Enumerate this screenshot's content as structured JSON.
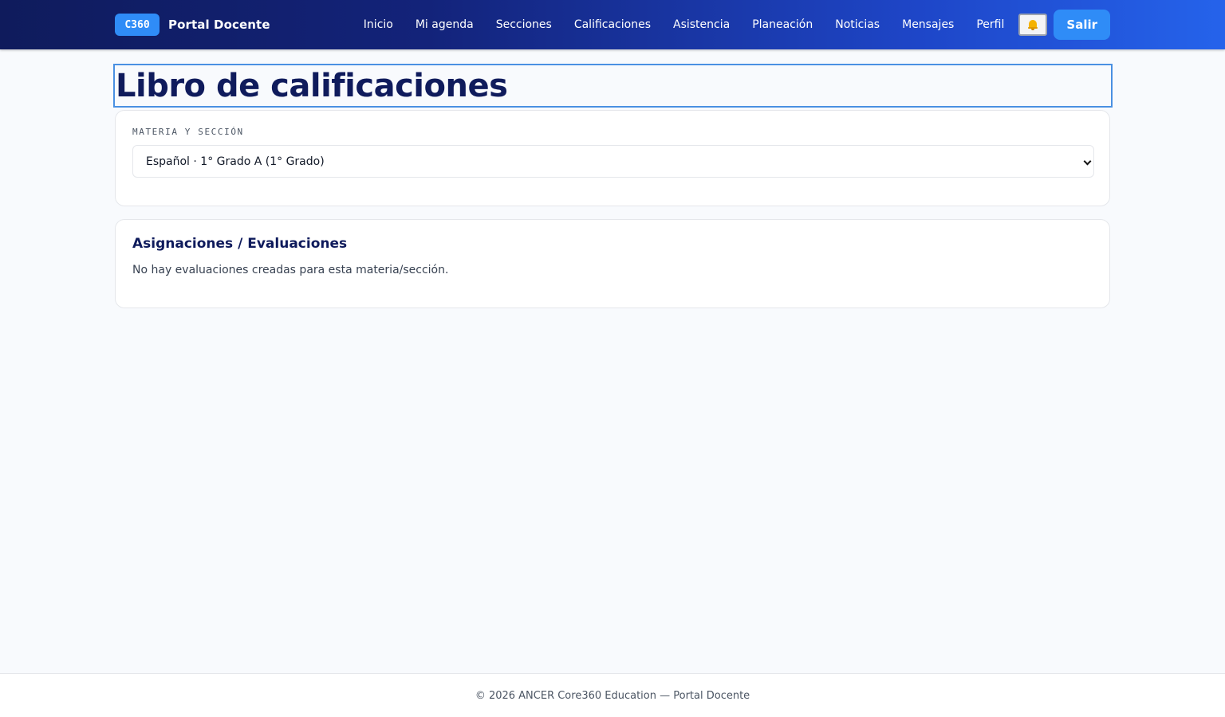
{
  "header": {
    "brand_badge": "C360",
    "brand_name": "Portal Docente",
    "nav": [
      {
        "label": "Inicio"
      },
      {
        "label": "Mi agenda"
      },
      {
        "label": "Secciones"
      },
      {
        "label": "Calificaciones"
      },
      {
        "label": "Asistencia"
      },
      {
        "label": "Planeación"
      },
      {
        "label": "Noticias"
      },
      {
        "label": "Mensajes"
      },
      {
        "label": "Perfil"
      }
    ],
    "notifications_icon": "bell-icon",
    "logout_label": "Salir"
  },
  "main": {
    "title": "Libro de calificaciones",
    "subject_section": {
      "label": "MATERIA Y SECCIÓN",
      "selected_value": "Español · 1° Grado A (1° Grado)"
    },
    "evaluations": {
      "title": "Asignaciones / Evaluaciones",
      "empty_message": "No hay evaluaciones creadas para esta materia/sección."
    }
  },
  "footer": {
    "text": "© 2026 ANCER Core360 Education — Portal Docente"
  },
  "colors": {
    "header_start": "#0f1b5c",
    "header_end": "#2563eb",
    "accent": "#2f8cf7",
    "title": "#0f1b5c",
    "background": "#f8fafd"
  }
}
